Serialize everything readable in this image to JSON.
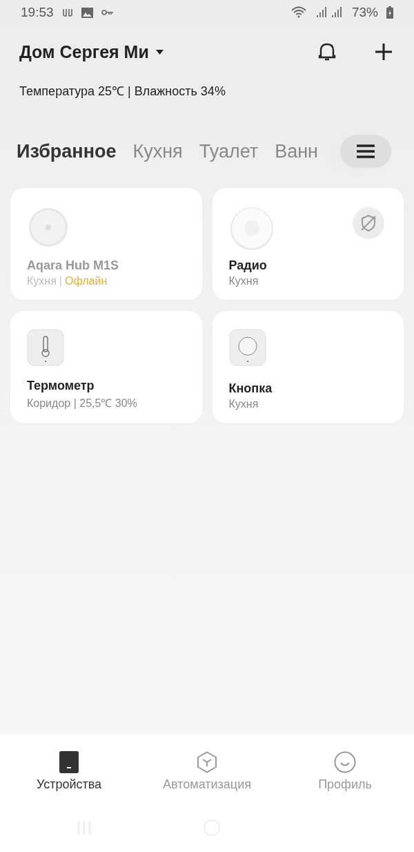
{
  "status_bar": {
    "time": "19:53",
    "battery": "73%"
  },
  "header": {
    "home_name": "Дом Сергея Ми",
    "climate": "Температура 25℃ | Влажность 34%"
  },
  "tabs": [
    {
      "label": "Избранное",
      "selected": true
    },
    {
      "label": "Кухня",
      "selected": false
    },
    {
      "label": "Туалет",
      "selected": false
    },
    {
      "label": "Ванн",
      "selected": false
    }
  ],
  "devices": [
    {
      "kind": "hub",
      "name": "Aqara Hub M1S",
      "room": "Кухня",
      "separator": "|",
      "status": "Офлайн",
      "offline": true,
      "badge": false
    },
    {
      "kind": "radio",
      "name": "Радио",
      "room": "Кухня",
      "offline": false,
      "badge": true
    },
    {
      "kind": "thermometer",
      "name": "Термометр",
      "room": "Коридор | 25,5℃ 30%",
      "offline": false,
      "badge": false
    },
    {
      "kind": "button",
      "name": "Кнопка",
      "room": "Кухня",
      "offline": false,
      "badge": false
    }
  ],
  "bottom_nav": [
    {
      "kind": "devices",
      "label": "Устройства",
      "selected": true
    },
    {
      "kind": "automation",
      "label": "Автоматизация",
      "selected": false
    },
    {
      "kind": "profile",
      "label": "Профиль",
      "selected": false
    }
  ]
}
